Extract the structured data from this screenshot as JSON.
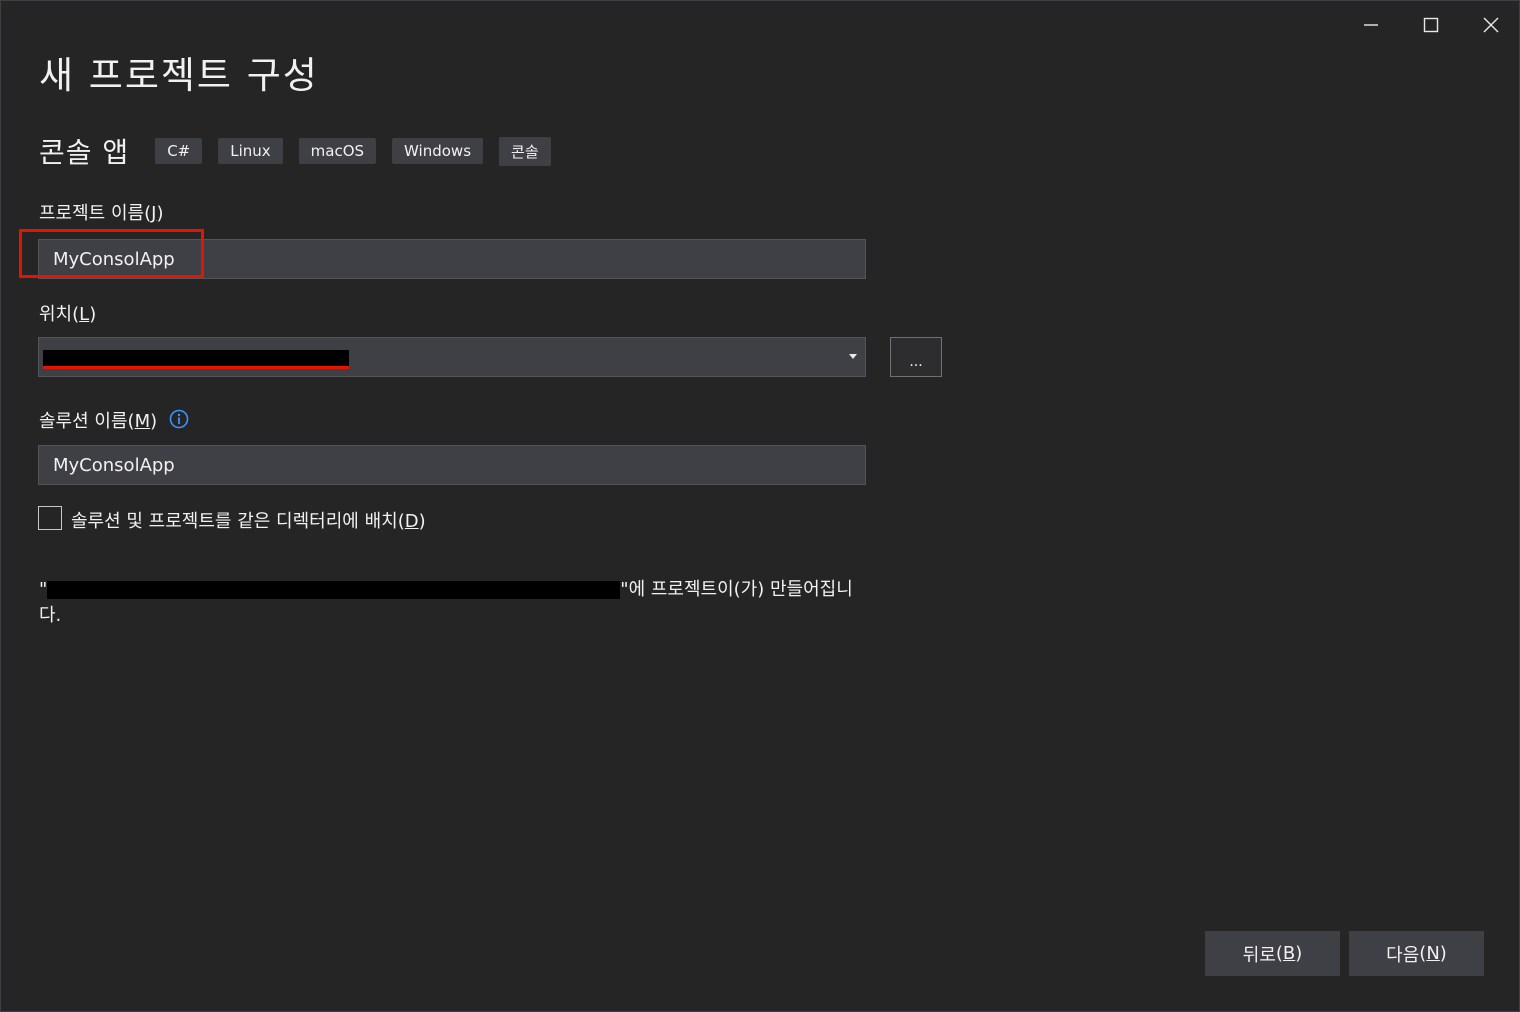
{
  "window": {
    "title": "새 프로젝트 구성",
    "controls": {
      "minimize_icon": "minimize-icon",
      "maximize_icon": "maximize-icon",
      "close_icon": "close-icon"
    }
  },
  "template": {
    "name": "콘솔 앱",
    "tags": [
      "C#",
      "Linux",
      "macOS",
      "Windows",
      "콘솔"
    ]
  },
  "project_name": {
    "label": "프로젝트 이름",
    "hotkey": "J",
    "value": "MyConsolApp"
  },
  "location": {
    "label": "위치",
    "hotkey": "L",
    "browse_label": "..."
  },
  "solution_name": {
    "label": "솔루션 이름",
    "hotkey": "M",
    "value": "MyConsolApp"
  },
  "same_directory": {
    "label": "솔루션 및 프로젝트를 같은 디렉터리에 배치",
    "hotkey": "D",
    "checked": false
  },
  "path_note": {
    "suffix": "에 프로젝트이(가) 만들어집니다."
  },
  "buttons": {
    "back_label": "뒤로",
    "back_hotkey": "B",
    "next_label": "다음",
    "next_hotkey": "N"
  },
  "colors": {
    "background": "#252526",
    "field": "#3f3f46",
    "highlight": "#e51400",
    "info": "#3794ff"
  }
}
